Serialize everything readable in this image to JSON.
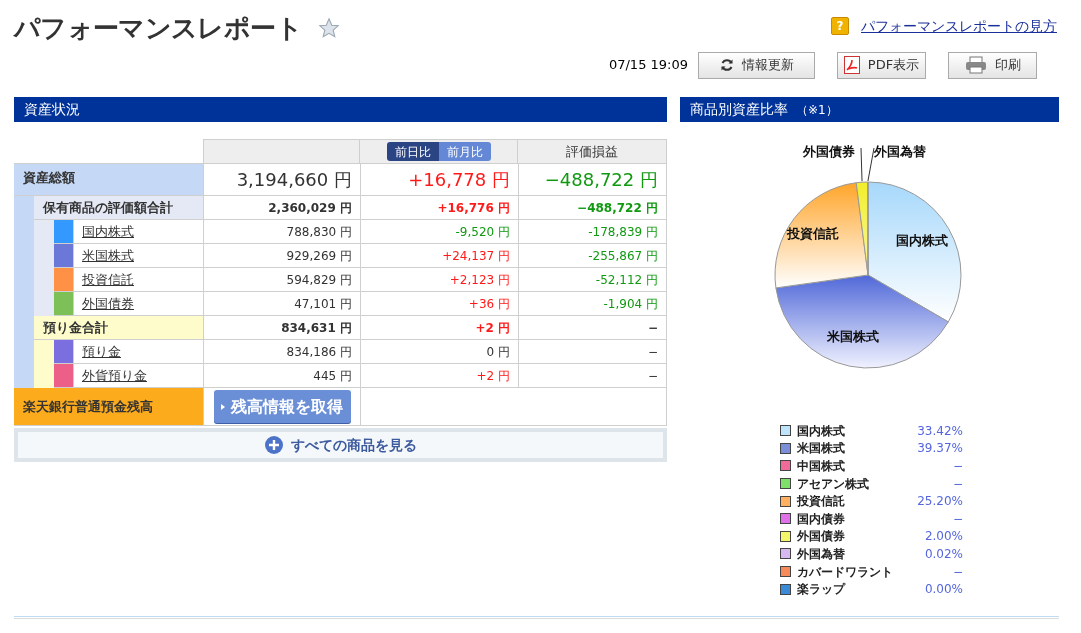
{
  "page_title": "パフォーマンスレポート",
  "favorite": false,
  "help_icon": "?",
  "help_link": "パフォーマンスレポートの見方",
  "updated_at": "07/15 19:09",
  "toolbar": [
    {
      "kind": "refresh",
      "label": "情報更新"
    },
    {
      "kind": "pdf",
      "label": "PDF表示"
    },
    {
      "kind": "print",
      "label": "印刷"
    }
  ],
  "assets": {
    "title": "資産状況",
    "period_tabs": [
      {
        "label": "前日比",
        "selected": true
      },
      {
        "label": "前月比",
        "selected": false
      }
    ],
    "gain_header": "評価損益",
    "total": {
      "label": "資産総額",
      "value": "3,194,660 円",
      "change": {
        "text": "+16,778 円",
        "color": "#ff1a1a"
      },
      "gain": {
        "text": "−488,722 円",
        "color": "#119911"
      }
    },
    "groups": [
      {
        "kind": "holdings",
        "label": "保有商品の評価額合計",
        "value": "2,360,029 円",
        "change": {
          "text": "+16,776 円",
          "color": "#ff1a1a"
        },
        "gain": {
          "text": "−488,722 円",
          "color": "#119911"
        },
        "items": [
          {
            "label": "国内株式",
            "color": "#3399ff",
            "value": "788,830 円",
            "change": {
              "text": "-9,520 円",
              "color": "#119911"
            },
            "gain": {
              "text": "-178,839 円",
              "color": "#119911"
            }
          },
          {
            "label": "米国株式",
            "color": "#6b78d8",
            "value": "929,269 円",
            "change": {
              "text": "+24,137 円",
              "color": "#ff1a1a"
            },
            "gain": {
              "text": "-255,867 円",
              "color": "#119911"
            }
          },
          {
            "label": "投資信託",
            "color": "#ff9147",
            "value": "594,829 円",
            "change": {
              "text": "+2,123 円",
              "color": "#ff1a1a"
            },
            "gain": {
              "text": "-52,112 円",
              "color": "#119911"
            }
          },
          {
            "label": "外国債券",
            "color": "#7dc057",
            "value": "47,101 円",
            "change": {
              "text": "+36 円",
              "color": "#ff1a1a"
            },
            "gain": {
              "text": "-1,904 円",
              "color": "#119911"
            }
          }
        ]
      },
      {
        "kind": "deposits",
        "label": "預り金合計",
        "value": "834,631 円",
        "change": {
          "text": "+2 円",
          "color": "#ff1a1a"
        },
        "gain": {
          "text": "−",
          "color": "#333333"
        },
        "items": [
          {
            "label": "預り金",
            "color": "#7b6fe0",
            "value": "834,186 円",
            "change": {
              "text": "0 円",
              "color": "#333333"
            },
            "gain": {
              "text": "−",
              "color": "#333333"
            }
          },
          {
            "label": "外貨預り金",
            "color": "#ec5f88",
            "value": "445 円",
            "change": {
              "text": "+2 円",
              "color": "#ff1a1a"
            },
            "gain": {
              "text": "−",
              "color": "#333333"
            }
          }
        ]
      }
    ],
    "bank": {
      "label": "楽天銀行普通預金残高",
      "button": "残高情報を取得"
    },
    "see_all": "すべての商品を見る"
  },
  "allocation": {
    "title": "商品別資産比率",
    "note": "（※1）",
    "chart_data": {
      "type": "pie",
      "categories": [
        "国内株式",
        "米国株式",
        "投資信託",
        "外国債券",
        "外国為替"
      ],
      "values": [
        33.42,
        39.37,
        25.2,
        2.0,
        0.02
      ]
    },
    "legend": [
      {
        "label": "国内株式",
        "color": "#bfe3fb",
        "value": "33.42%"
      },
      {
        "label": "米国株式",
        "color": "#7b8fd8",
        "value": "39.37%"
      },
      {
        "label": "中国株式",
        "color": "#f06a9a",
        "value": "−"
      },
      {
        "label": "アセアン株式",
        "color": "#7ee06a",
        "value": "−"
      },
      {
        "label": "投資信託",
        "color": "#ffb060",
        "value": "25.20%"
      },
      {
        "label": "国内債券",
        "color": "#e070e8",
        "value": "−"
      },
      {
        "label": "外国債券",
        "color": "#f5f56a",
        "value": "2.00%"
      },
      {
        "label": "外国為替",
        "color": "#d8b8f0",
        "value": "0.02%"
      },
      {
        "label": "カバードワラント",
        "color": "#f58a5a",
        "value": "−"
      },
      {
        "label": "楽ラップ",
        "color": "#3a8ad8",
        "value": "0.00%"
      }
    ]
  }
}
